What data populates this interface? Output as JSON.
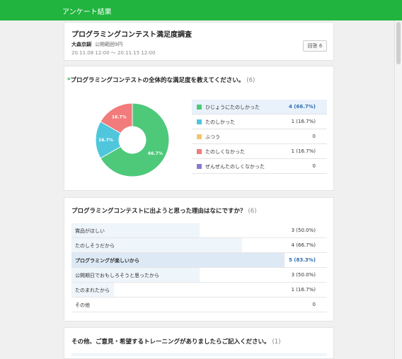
{
  "header": {
    "title": "アンケート結果"
  },
  "survey": {
    "title": "プログラミングコンテスト満足度調査",
    "author": "大森京騎",
    "separator": "|",
    "department": "公開範囲9円",
    "period": "20.11.08 12:00 ～ 20.11.15 12:00",
    "response_badge": "回答 6"
  },
  "q1": {
    "required_mark": "*",
    "title": "プログラミングコンテストの全体的な満足度を教えてください。",
    "count": "(6)",
    "options": [
      {
        "label": "ひじょうにたのしかった",
        "count": "4",
        "pct": "(66.7%)",
        "color": "#4ec97a",
        "highlight": true
      },
      {
        "label": "たのしかった",
        "count": "1",
        "pct": "(16.7%)",
        "color": "#4fc6dc",
        "highlight": false
      },
      {
        "label": "ふつう",
        "count": "0",
        "pct": "",
        "color": "#f5c46b",
        "highlight": false
      },
      {
        "label": "たのしくなかった",
        "count": "1",
        "pct": "(16.7%)",
        "color": "#f27b7b",
        "highlight": false
      },
      {
        "label": "ぜんぜんたのしくなかった",
        "count": "0",
        "pct": "",
        "color": "#8a79cf",
        "highlight": false
      }
    ]
  },
  "chart_data": {
    "type": "pie",
    "categories": [
      "ひじょうにたのしかった",
      "たのしかった",
      "ふつう",
      "たのしくなかった",
      "ぜんぜんたのしくなかった"
    ],
    "values": [
      4,
      1,
      0,
      1,
      0
    ],
    "slice_labels": [
      "66.7%",
      "16.7%",
      "",
      "16.7%",
      ""
    ],
    "colors": [
      "#4ec97a",
      "#4fc6dc",
      "#f5c46b",
      "#f27b7b",
      "#8a79cf"
    ]
  },
  "q2": {
    "title": "プログラミングコンテストに出ようと思った理由はなにですか？",
    "count": "(6)",
    "options": [
      {
        "label": "賞品がほしい",
        "count": "3",
        "pct": "(50.0%)",
        "ratio": 0.5,
        "highlight": false
      },
      {
        "label": "たのしそうだから",
        "count": "4",
        "pct": "(66.7%)",
        "ratio": 0.667,
        "highlight": false
      },
      {
        "label": "プログラミングが楽しいから",
        "count": "5",
        "pct": "(83.3%)",
        "ratio": 0.833,
        "highlight": true
      },
      {
        "label": "公開期日でおもしろそうと思ったから",
        "count": "3",
        "pct": "(50.0%)",
        "ratio": 0.5,
        "highlight": false
      },
      {
        "label": "たのまれたから",
        "count": "1",
        "pct": "(16.7%)",
        "ratio": 0.167,
        "highlight": false
      },
      {
        "label": "その他",
        "count": "0",
        "pct": "",
        "ratio": 0,
        "highlight": false
      }
    ]
  },
  "q3": {
    "title": "その他、ご意見・希望するトレーニングがありましたらご記入ください。",
    "count": "(1)"
  }
}
